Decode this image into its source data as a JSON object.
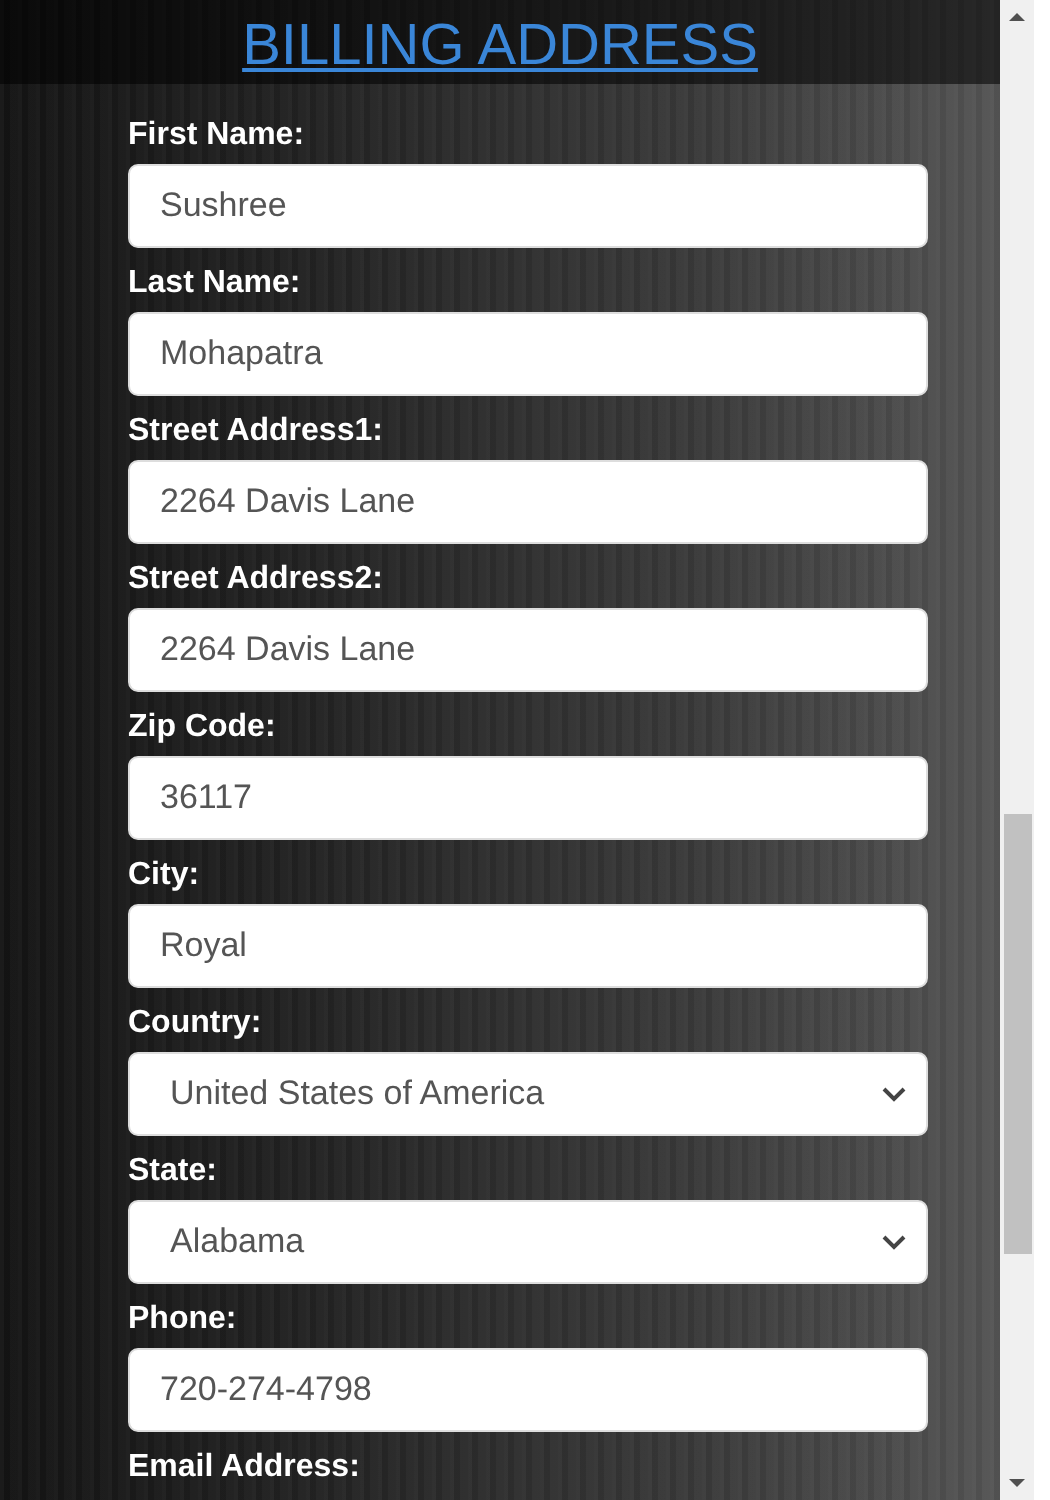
{
  "title": "BILLING ADDRESS",
  "fields": [
    {
      "label": "First Name:",
      "kind": "text",
      "value": "Sushree"
    },
    {
      "label": "Last Name:",
      "kind": "text",
      "value": "Mohapatra"
    },
    {
      "label": "Street Address1:",
      "kind": "text",
      "value": "2264 Davis Lane"
    },
    {
      "label": "Street Address2:",
      "kind": "text",
      "value": "2264 Davis Lane"
    },
    {
      "label": "Zip Code:",
      "kind": "text",
      "value": "36117"
    },
    {
      "label": "City:",
      "kind": "text",
      "value": "Royal"
    },
    {
      "label": "Country:",
      "kind": "select",
      "value": "United States of America"
    },
    {
      "label": "State:",
      "kind": "select",
      "value": "Alabama"
    },
    {
      "label": "Phone:",
      "kind": "text",
      "value": "720-274-4798"
    },
    {
      "label": "Email Address:"
    }
  ]
}
